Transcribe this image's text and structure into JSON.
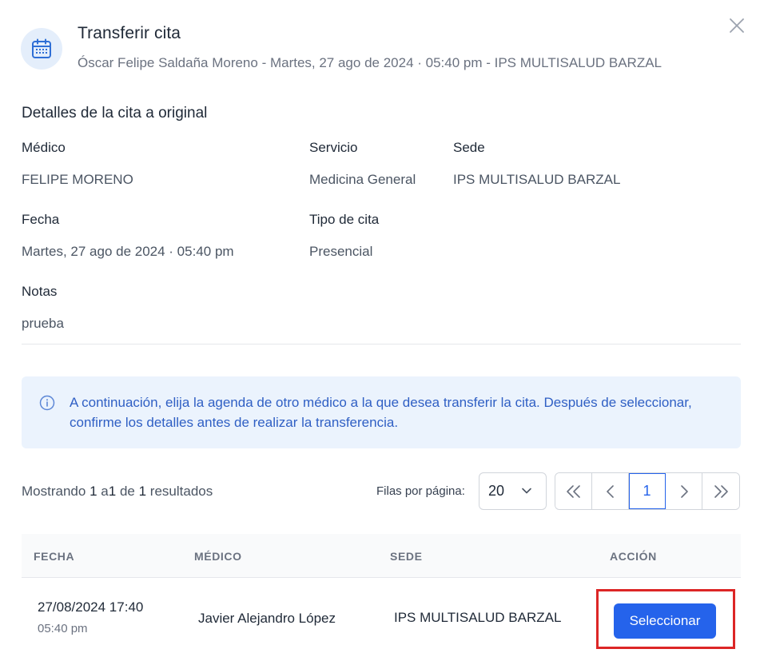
{
  "header": {
    "title": "Transferir cita",
    "subtitle": "Óscar Felipe Saldaña Moreno - Martes, 27 ago de 2024 · 05:40 pm - IPS MULTISALUD BARZAL",
    "icon": "calendar-icon",
    "close_icon": "close-icon"
  },
  "details": {
    "section_title": "Detalles de la cita a original",
    "medico_label": "Médico",
    "medico_value": "FELIPE MORENO",
    "servicio_label": "Servicio",
    "servicio_value": "Medicina General",
    "sede_label": "Sede",
    "sede_value": "IPS MULTISALUD BARZAL",
    "fecha_label": "Fecha",
    "fecha_value": "Martes, 27 ago de 2024 · 05:40 pm",
    "tipo_label": "Tipo de cita",
    "tipo_value": "Presencial",
    "notas_label": "Notas",
    "notas_value": "prueba"
  },
  "info": {
    "icon": "info-icon",
    "text": "A continuación, elija la agenda de otro médico a la que desea transferir la cita. Después de seleccionar, confirme los detalles antes de realizar la transferencia."
  },
  "pagination": {
    "showing_prefix": "Mostrando",
    "from": "1",
    "to_word": "a",
    "to": "1",
    "of_word": "de",
    "total": "1",
    "results_word": "resultados",
    "rows_label": "Filas por página:",
    "rows_value": "20",
    "current_page": "1"
  },
  "table": {
    "headers": [
      "FECHA",
      "MÉDICO",
      "SEDE",
      "ACCIÓN"
    ],
    "rows": [
      {
        "fecha": "27/08/2024 17:40",
        "hora": "05:40 pm",
        "medico": "Javier Alejandro López",
        "sede": "IPS MULTISALUD BARZAL",
        "action_label": "Seleccionar"
      }
    ]
  },
  "colors": {
    "primary": "#2563eb",
    "info_bg": "#ebf3fd",
    "info_text": "#2f5fc4",
    "highlight": "#dc2626"
  }
}
